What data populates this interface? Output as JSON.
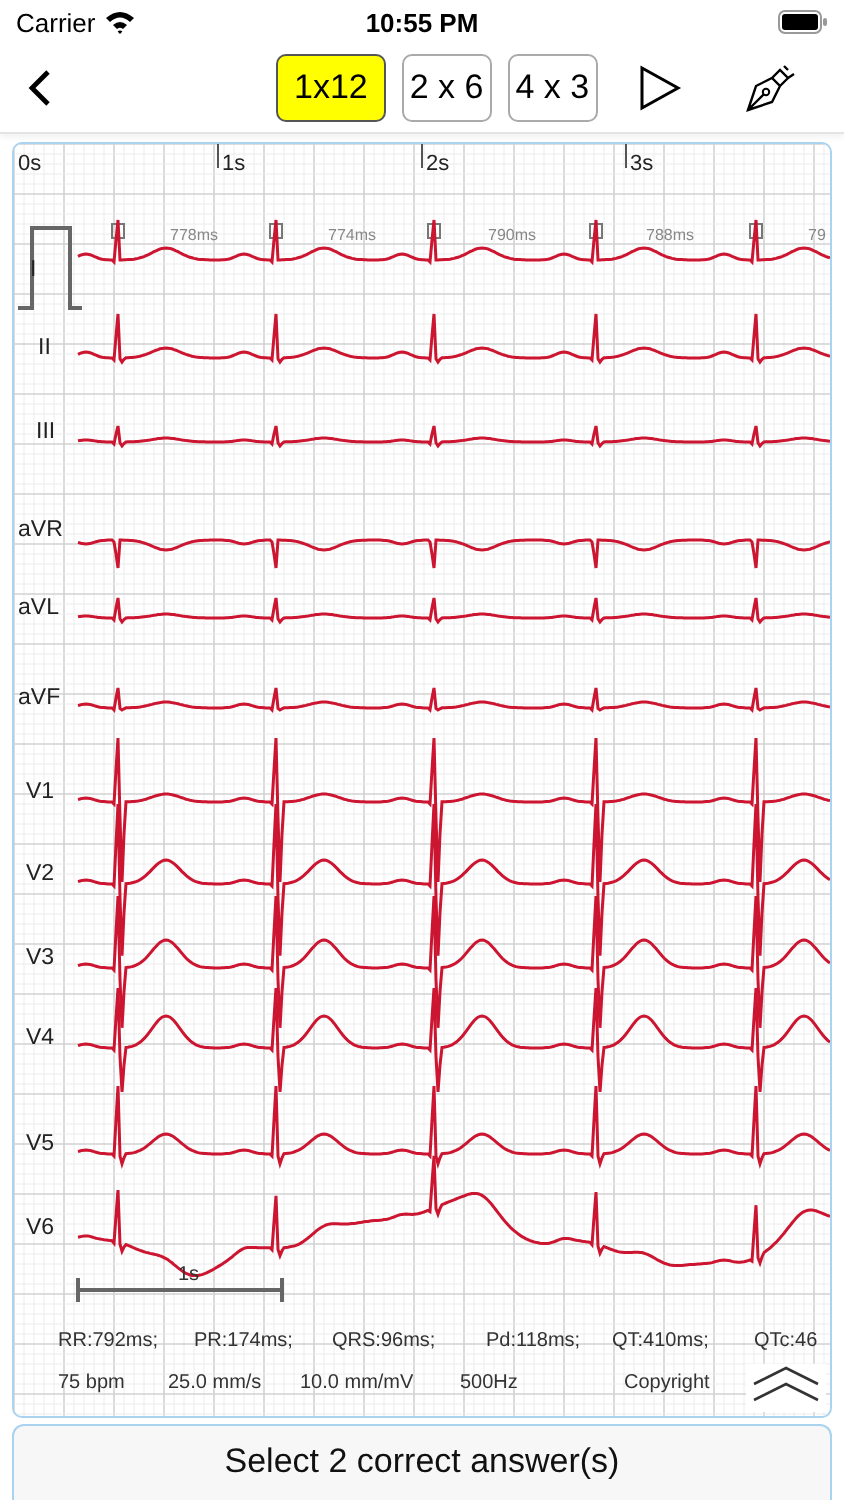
{
  "status_bar": {
    "carrier": "Carrier",
    "time": "10:55 PM"
  },
  "toolbar": {
    "layouts": [
      {
        "label": "1x12",
        "selected": true
      },
      {
        "label": "2 x 6",
        "selected": false
      },
      {
        "label": "4 x 3",
        "selected": false
      }
    ]
  },
  "ecg": {
    "time_labels": [
      "0s",
      "1s",
      "2s",
      "3s"
    ],
    "intervals": [
      "778ms",
      "774ms",
      "790ms",
      "788ms",
      "79"
    ],
    "leads": [
      {
        "name": "I"
      },
      {
        "name": "II"
      },
      {
        "name": "III"
      },
      {
        "name": "aVR"
      },
      {
        "name": "aVL"
      },
      {
        "name": "aVF"
      },
      {
        "name": "V1"
      },
      {
        "name": "V2"
      },
      {
        "name": "V3"
      },
      {
        "name": "V4"
      },
      {
        "name": "V5"
      },
      {
        "name": "V6"
      }
    ],
    "scale_label": "1s",
    "measurements": [
      "RR:792ms;",
      "PR:174ms;",
      "QRS:96ms;",
      "Pd:118ms;",
      "QT:410ms;",
      "QTc:46"
    ],
    "settings": [
      "75 bpm",
      "25.0 mm/s",
      "10.0 mm/mV",
      "500Hz",
      "Copyright"
    ]
  },
  "answer_prompt": "Select 2 correct answer(s)"
}
